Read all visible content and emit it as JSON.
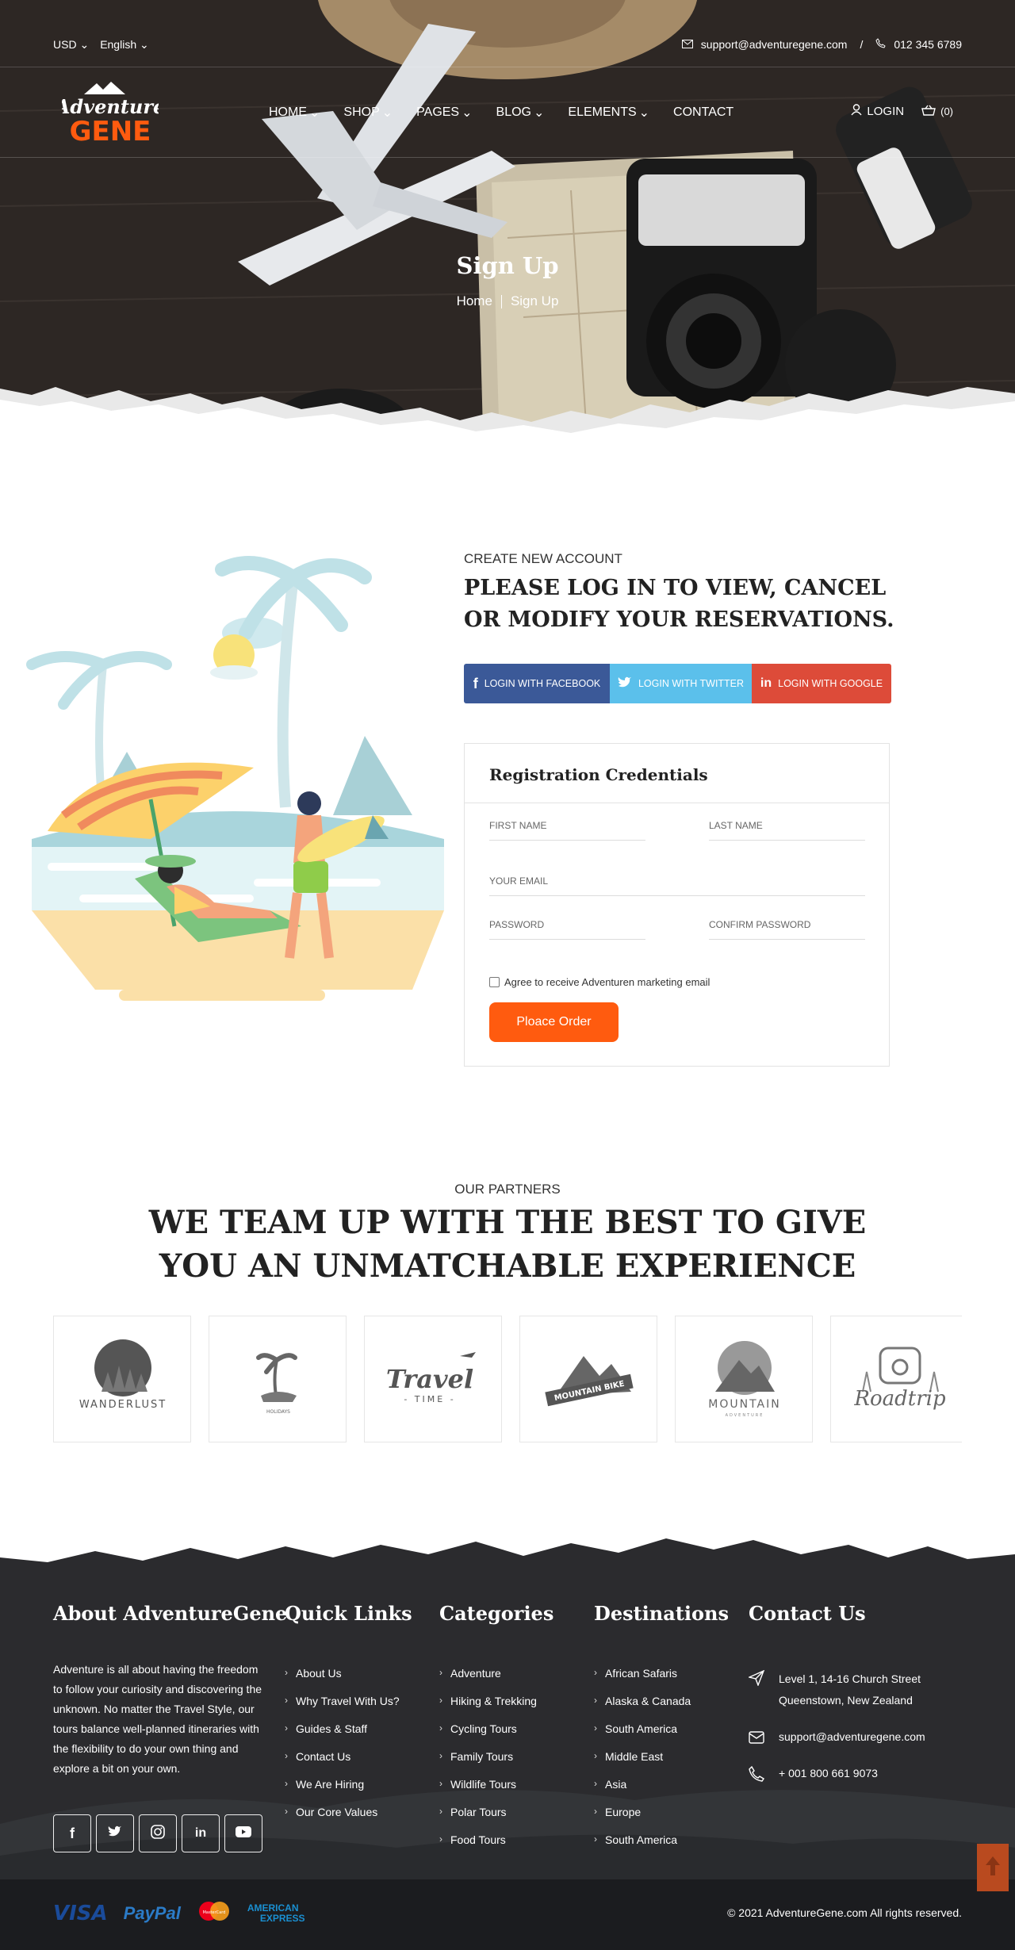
{
  "topbar": {
    "currency": "USD",
    "language": "English",
    "email": "support@adventuregene.com",
    "divider": "/",
    "phone": "012 345 6789"
  },
  "logo": {
    "line1": "Adventure",
    "line2": "GENE"
  },
  "nav": {
    "items": [
      "HOME",
      "SHOP",
      "PAGES",
      "BLOG",
      "ELEMENTS",
      "CONTACT"
    ],
    "login": "LOGIN",
    "cart": "(0)"
  },
  "hero": {
    "title": "Sign Up",
    "breadcrumb": [
      "Home",
      "Sign Up"
    ]
  },
  "register": {
    "subtitle": "CREATE NEW ACCOUNT",
    "title": "PLEASE LOG IN TO VIEW, CANCEL OR MODIFY YOUR RESERVATIONS.",
    "social": {
      "facebook": "LOGIN WITH FACEBOOK",
      "twitter": "LOGIN WITH TWITTER",
      "google": "LOGIN WITH GOOGLE"
    },
    "form": {
      "heading": "Registration Credentials",
      "first_name": "FIRST NAME",
      "last_name": "LAST NAME",
      "email": "YOUR EMAIL",
      "password": "PASSWORD",
      "confirm_password": "CONFIRM PASSWORD",
      "agree": "Agree to receive Adventuren marketing email",
      "submit": "Ploace Order"
    }
  },
  "partners": {
    "subtitle": "OUR PARTNERS",
    "title": "WE TEAM UP WITH THE BEST TO GIVE YOU AN UNMATCHABLE EXPERIENCE",
    "logos": [
      "WANDERLUST",
      "HOLIDAYS",
      "Travel TIME",
      "MOUNTAIN BIKE",
      "MOUNTAIN",
      "Roadtrip"
    ],
    "logo_sub": {
      "holidays": "HOLIDAYS",
      "travel_time": "- TIME -",
      "mountain": "ADVENTURE"
    }
  },
  "footer": {
    "about": {
      "heading": "About AdventureGene",
      "text": "Adventure is all about having the freedom to follow your curiosity and discovering the unknown. No matter the Travel Style, our tours balance well-planned itineraries with the flexibility to do your own thing and explore a bit on your own."
    },
    "quick_links": {
      "heading": "Quick Links",
      "items": [
        "About Us",
        "Why Travel With Us?",
        "Guides & Staff",
        "Contact Us",
        "We Are Hiring",
        "Our Core Values"
      ]
    },
    "categories": {
      "heading": "Categories",
      "items": [
        "Adventure",
        "Hiking & Trekking",
        "Cycling Tours",
        "Family Tours",
        "Wildlife Tours",
        "Polar Tours",
        "Food Tours"
      ]
    },
    "destinations": {
      "heading": "Destinations",
      "items": [
        "African Safaris",
        "Alaska & Canada",
        "South America",
        "Middle East",
        "Asia",
        "Europe",
        "South America"
      ]
    },
    "contact": {
      "heading": "Contact Us",
      "address_line1": "Level 1, 14-16 Church Street",
      "address_line2": "Queenstown, New Zealand",
      "email": "support@adventuregene.com",
      "phone": "+ 001 800 661 9073"
    },
    "payments": [
      "VISA",
      "PayPal",
      "MasterCard",
      "AMERICAN",
      "EXPRESS"
    ],
    "copyright": "© 2021 AdventureGene.com All rights reserved."
  },
  "colors": {
    "accent": "#ff5b0f",
    "facebook": "#3b5998",
    "twitter": "#5bc0eb",
    "google": "#dd4b39",
    "footer_bg": "#2b2b2e"
  }
}
